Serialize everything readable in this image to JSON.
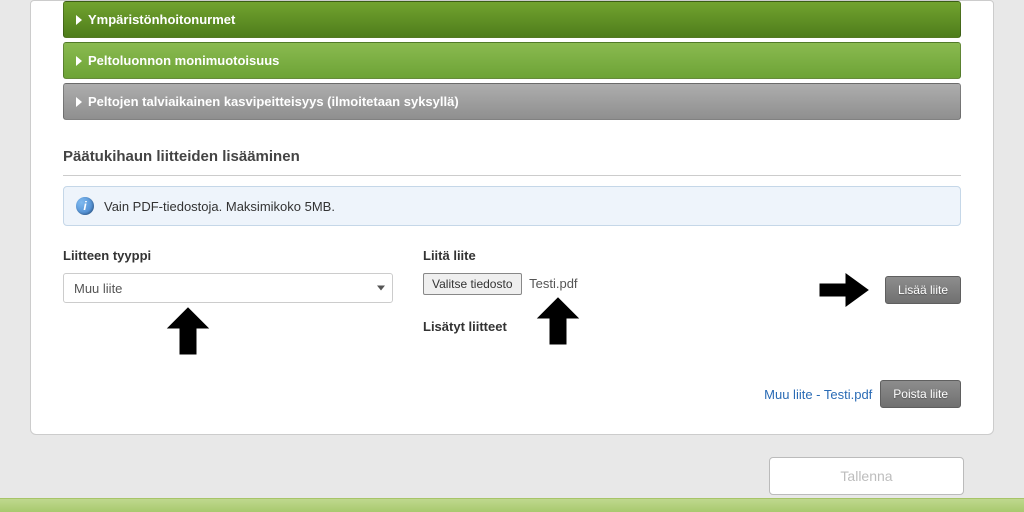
{
  "accordion": {
    "items": [
      {
        "label": "Ympäristönhoitonurmet"
      },
      {
        "label": "Peltoluonnon monimuotoisuus"
      },
      {
        "label": "Peltojen talviaikainen kasvipeitteisyys (ilmoitetaan syksyllä)"
      }
    ]
  },
  "attachments": {
    "section_title": "Päätukihaun liitteiden lisääminen",
    "info_text": "Vain PDF-tiedostoja. Maksimikoko 5MB.",
    "type_label": "Liitteen tyyppi",
    "type_selected": "Muu liite",
    "attach_label": "Liitä liite",
    "choose_file_label": "Valitse tiedosto",
    "chosen_file_name": "Testi.pdf",
    "add_button_label": "Lisää liite",
    "added_heading": "Lisätyt liitteet",
    "list": [
      {
        "display": "Muu liite - Testi.pdf"
      }
    ],
    "remove_button_label": "Poista liite"
  },
  "actions": {
    "save_label": "Tallenna"
  }
}
